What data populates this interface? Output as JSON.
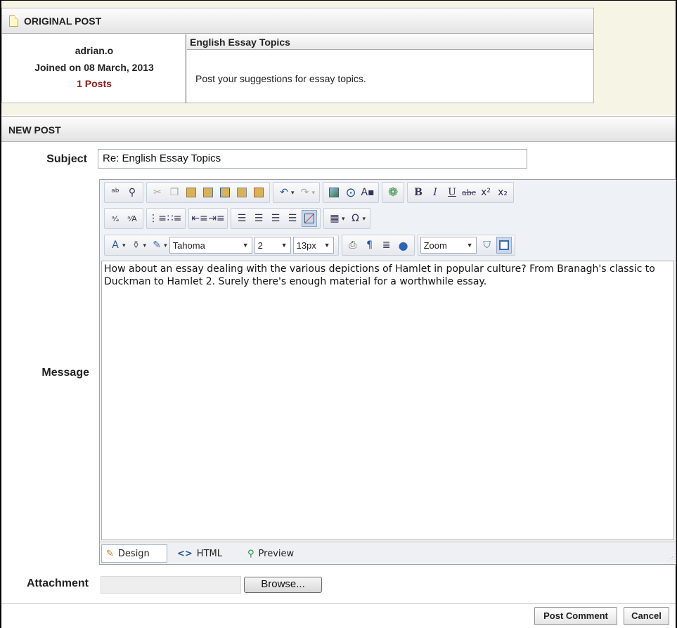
{
  "original_post": {
    "header": "ORIGINAL POST",
    "author": {
      "name": "adrian.o",
      "joined": "Joined on 08 March, 2013",
      "posts": "1 Posts"
    },
    "topic_title": "English Essay Topics",
    "body": "Post your suggestions for essay topics."
  },
  "new_post": {
    "header": "NEW POST",
    "subject_label": "Subject",
    "subject_value": "Re: English Essay Topics",
    "message_label": "Message",
    "message_text": "How about an essay dealing with the various depictions of Hamlet in popular culture? From Branagh's classic to Duckman to Hamlet 2. Surely there's enough material for a worthwhile essay.",
    "attachment_label": "Attachment",
    "browse_label": "Browse...",
    "post_comment_label": "Post Comment",
    "cancel_label": "Cancel"
  },
  "editor": {
    "font_name": "Tahoma",
    "font_size": "2",
    "font_px": "13px",
    "zoom": "Zoom",
    "modes": [
      "Design",
      "HTML",
      "Preview"
    ],
    "active_mode": "Design"
  },
  "colors": {
    "accent": "#8b1a1a",
    "cream_background": "#f6f4e4",
    "toolbar_background": "#eef1f6"
  }
}
